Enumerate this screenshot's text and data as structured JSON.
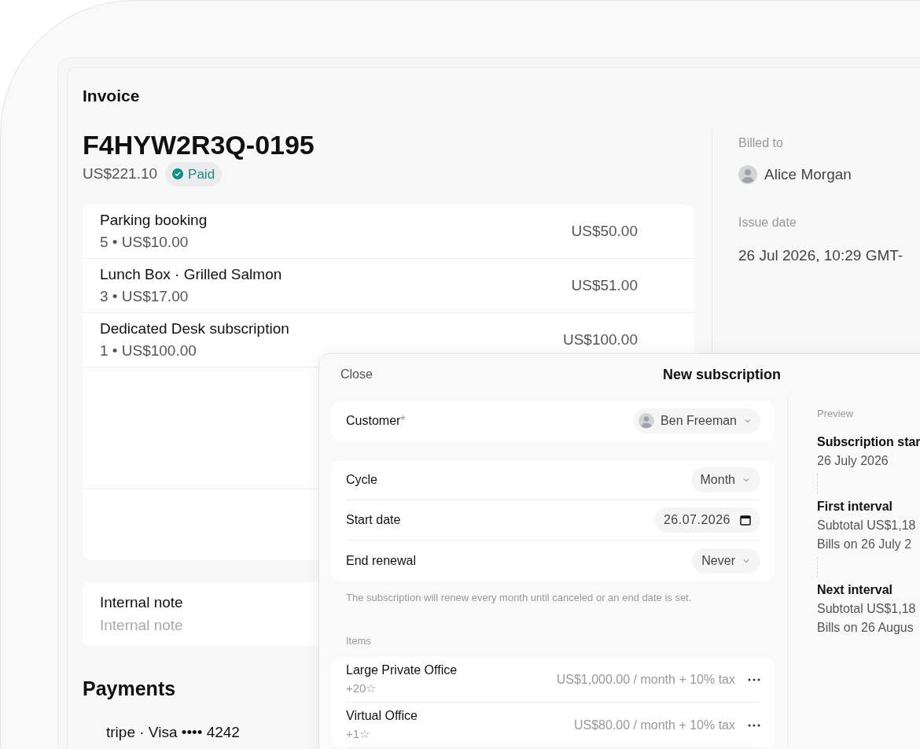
{
  "invoice": {
    "heading": "Invoice",
    "number": "F4HYW2R3Q-0195",
    "total": "US$221.10",
    "status": {
      "label": "Paid",
      "kind": "paid"
    },
    "lines": [
      {
        "name": "Parking booking",
        "detail": "5 • US$10.00",
        "amount": "US$50.00"
      },
      {
        "name": "Lunch Box · Grilled Salmon",
        "detail": "3 • US$17.00",
        "amount": "US$51.00"
      },
      {
        "name": "Dedicated Desk subscription",
        "detail": "1 • US$100.00",
        "amount": "US$100.00"
      }
    ],
    "note": {
      "label": "Internal note",
      "placeholder": "Internal note"
    },
    "payments": {
      "title": "Payments",
      "method": "tripe · Visa •••• 4242"
    },
    "billed_to": {
      "label": "Billed to",
      "name": "Alice Morgan"
    },
    "issue_date": {
      "label": "Issue date",
      "value": "26 Jul 2026, 10:29 GMT-"
    }
  },
  "modal": {
    "close": "Close",
    "title": "New subscription",
    "customer": {
      "label": "Customer",
      "mark": "*",
      "value": "Ben Freeman"
    },
    "fields": [
      {
        "kind": "select",
        "label": "Cycle",
        "value": "Month"
      },
      {
        "kind": "date",
        "label": "Start date",
        "value": "26.07.2026"
      },
      {
        "kind": "select",
        "label": "End renewal",
        "value": "Never"
      }
    ],
    "hint": "The subscription will renew every month until canceled or an end date is set.",
    "items_label": "Items",
    "items": [
      {
        "name": "Large Private Office",
        "extra": "+20☆",
        "price": "US$1,000.00 / month + 10% tax"
      },
      {
        "name": "Virtual Office",
        "extra": "+1☆",
        "price": "US$80.00 / month + 10% tax"
      }
    ],
    "preview": {
      "label": "Preview",
      "steps": [
        {
          "title": "Subscription star",
          "lines": [
            "26 July 2026"
          ]
        },
        {
          "title": "First interval",
          "lines": [
            "Subtotal US$1,18",
            "Bills on 26 July 2"
          ]
        },
        {
          "title": "Next interval",
          "lines": [
            "Subtotal US$1,18",
            "Bills on 26 Augus"
          ]
        }
      ]
    }
  }
}
